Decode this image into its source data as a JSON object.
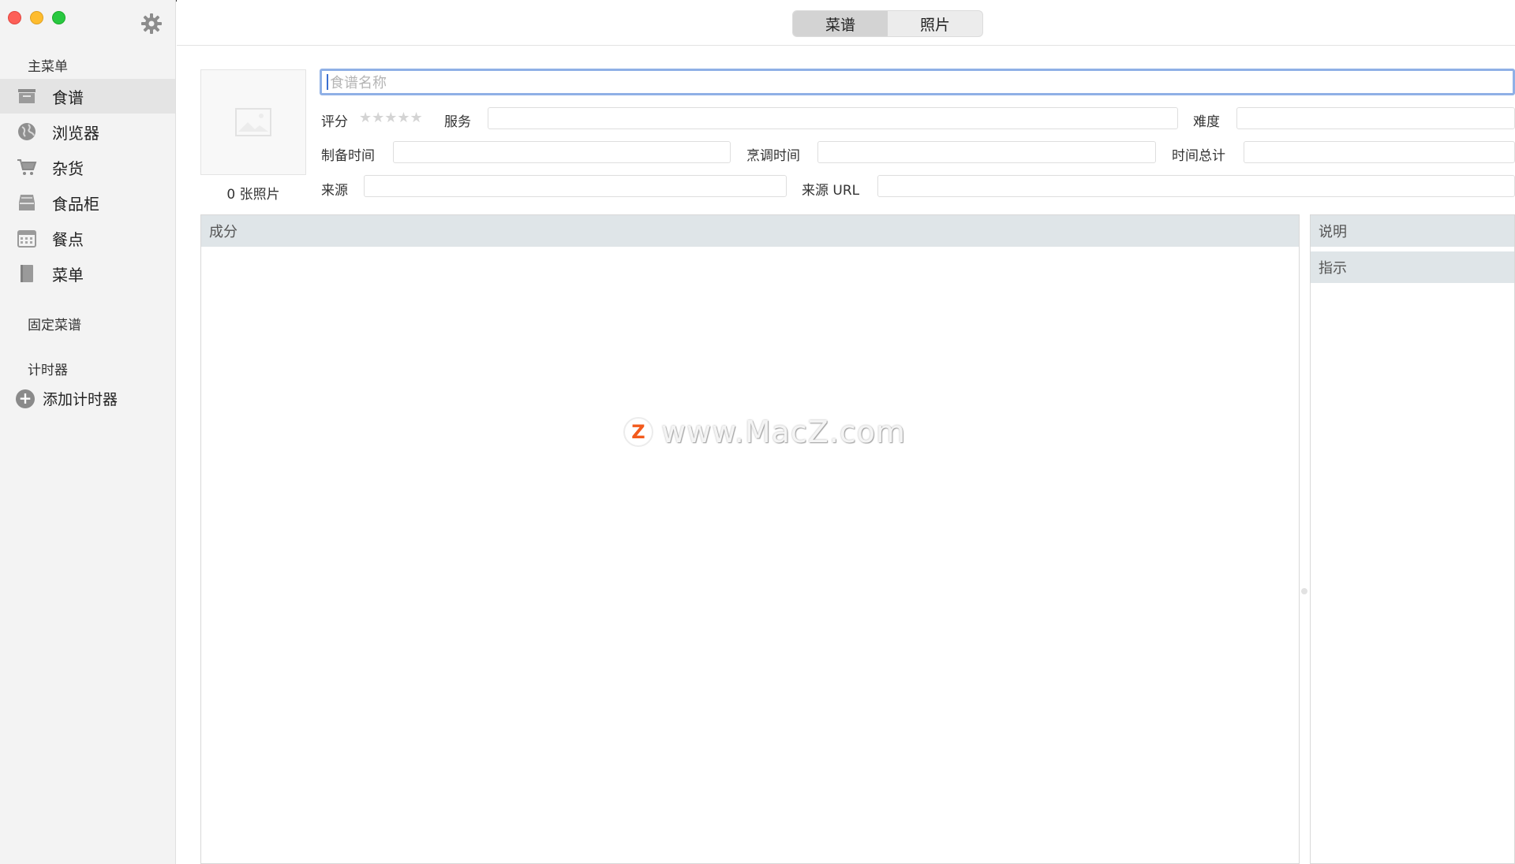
{
  "window": {
    "buttons": [
      "close",
      "minimize",
      "maximize"
    ],
    "settings_icon": "gear-icon"
  },
  "sidebar": {
    "main_menu_title": "主菜单",
    "items": [
      {
        "label": "食谱",
        "icon": "recipe-box-icon",
        "selected": true
      },
      {
        "label": "浏览器",
        "icon": "globe-icon",
        "selected": false
      },
      {
        "label": "杂货",
        "icon": "cart-icon",
        "selected": false
      },
      {
        "label": "食品柜",
        "icon": "pantry-icon",
        "selected": false
      },
      {
        "label": "餐点",
        "icon": "calendar-icon",
        "selected": false
      },
      {
        "label": "菜单",
        "icon": "book-icon",
        "selected": false
      }
    ],
    "pinned_title": "固定菜谱",
    "timers_title": "计时器",
    "add_timer_label": "添加计时器"
  },
  "tabs": {
    "items": [
      "菜谱",
      "照片"
    ],
    "active": "菜谱"
  },
  "recipe": {
    "name_placeholder": "食谱名称",
    "photo_count_label": "0 张照片",
    "rating_label": "评分",
    "rating_stars": "★★★★★",
    "rating_value": 0,
    "servings_label": "服务",
    "difficulty_label": "难度",
    "prep_time_label": "制备时间",
    "cook_time_label": "烹调时间",
    "total_time_label": "时间总计",
    "source_label": "来源",
    "source_url_label": "来源 URL"
  },
  "panels": {
    "ingredients_title": "成分",
    "description_title": "说明",
    "directions_title": "指示"
  },
  "watermark": {
    "logo_letter": "Z",
    "text": "www.MacZ.com"
  },
  "colors": {
    "sidebar_bg": "#f3f3f3",
    "selected_item_bg": "#e4e4e4",
    "panel_header_bg": "#dfe5e8",
    "focus_ring": "#8fb0e6",
    "close": "#fd5f57",
    "minimize": "#febc2e",
    "maximize": "#28c840"
  }
}
